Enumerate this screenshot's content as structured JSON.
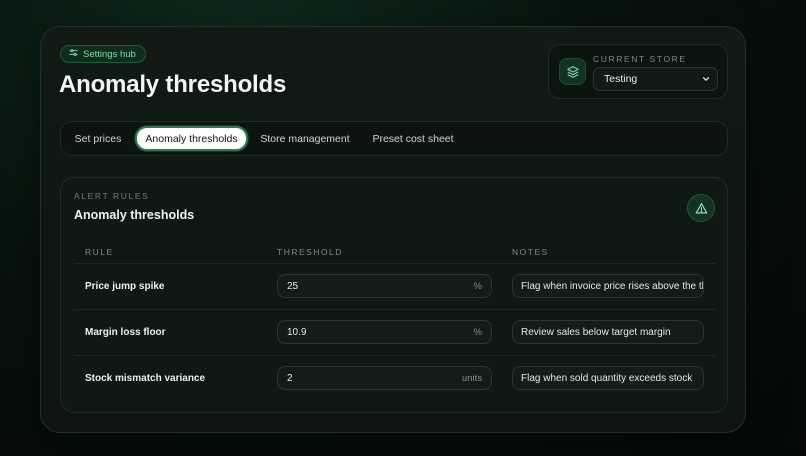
{
  "header": {
    "hub_badge": "Settings hub",
    "title": "Anomaly thresholds"
  },
  "store": {
    "label": "CURRENT STORE",
    "selected": "Testing"
  },
  "tabs": [
    {
      "label": "Set prices",
      "active": false
    },
    {
      "label": "Anomaly thresholds",
      "active": true
    },
    {
      "label": "Store management",
      "active": false
    },
    {
      "label": "Preset cost sheet",
      "active": false
    }
  ],
  "rules": {
    "eyebrow": "ALERT RULES",
    "title": "Anomaly thresholds",
    "columns": {
      "rule": "RULE",
      "threshold": "THRESHOLD",
      "notes": "NOTES"
    },
    "rows": [
      {
        "rule": "Price jump spike",
        "threshold": "25",
        "unit": "%",
        "note": "Flag when invoice price rises above the th"
      },
      {
        "rule": "Margin loss floor",
        "threshold": "10.9",
        "unit": "%",
        "note": "Review sales below target margin"
      },
      {
        "rule": "Stock mismatch variance",
        "threshold": "2",
        "unit": "units",
        "note": "Flag when sold quantity exceeds stock"
      }
    ]
  },
  "icons": {
    "hub": "sliders-icon",
    "store": "layers-icon",
    "select": "chevron-down-icon",
    "alert": "warning-triangle-icon"
  },
  "colors": {
    "accent": "#7fd8a6",
    "active_tab_border": "#2f7a52"
  }
}
